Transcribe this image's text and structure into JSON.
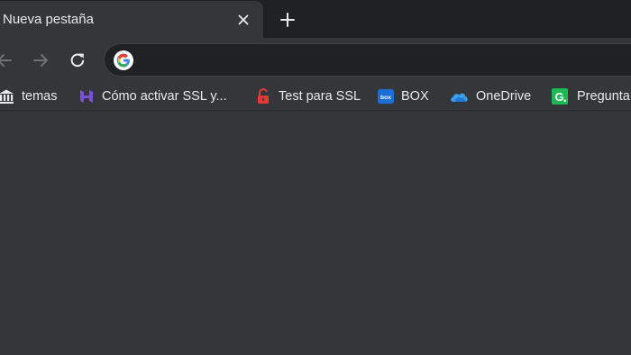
{
  "tab": {
    "title": "Nueva pestaña",
    "close_icon": "close-icon",
    "new_tab_icon": "plus-icon"
  },
  "toolbar": {
    "back_icon": "arrow-left-icon",
    "forward_icon": "arrow-right-icon",
    "reload_icon": "reload-icon",
    "omnibox": {
      "value": "",
      "icon": "google-g-icon"
    }
  },
  "bookmarks": [
    {
      "label": "temas",
      "icon": "bank-icon"
    },
    {
      "label": "Cómo activar SSL y...",
      "icon": "hostinger-icon"
    },
    {
      "label": "Test para SSL",
      "icon": "unlock-icon"
    },
    {
      "label": "BOX",
      "icon": "box-icon"
    },
    {
      "label": "OneDrive",
      "icon": "onedrive-icon"
    },
    {
      "label": "Pregunta",
      "icon": "g-green-icon"
    }
  ],
  "colors": {
    "tabstrip": "#202124",
    "toolbar": "#35363a",
    "text": "#e8eaed"
  }
}
